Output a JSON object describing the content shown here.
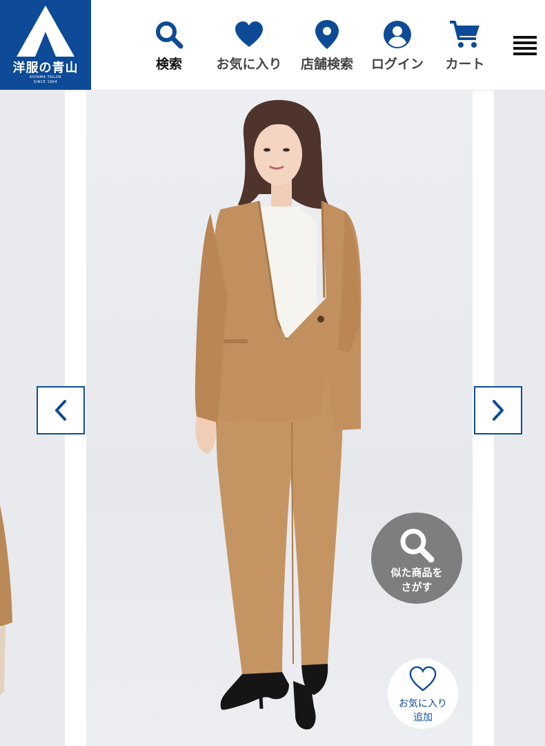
{
  "brand": {
    "name": "洋服の青山",
    "tagline_line1": "AOYAMA TAILOR",
    "tagline_line2": "SINCE 1964",
    "color": "#0d4a97"
  },
  "nav": {
    "search_label": "検索",
    "favorites_label": "お気に入り",
    "store_search_label": "店舗検索",
    "login_label": "ログイン",
    "cart_label": "カート",
    "icons": [
      "search-icon",
      "heart-icon",
      "map-pin-icon",
      "user-icon",
      "cart-icon",
      "hamburger-menu-icon"
    ]
  },
  "gallery": {
    "prev_icon": "chevron-left-icon",
    "next_icon": "chevron-right-icon",
    "similar_line1": "似た商品を",
    "similar_line2": "さがす",
    "favorite_line1": "お気に入り",
    "favorite_line2": "追加",
    "product_colors": {
      "suit": "#c1905e",
      "blouse": "#f6f4ef",
      "background": "#eaebef"
    }
  }
}
